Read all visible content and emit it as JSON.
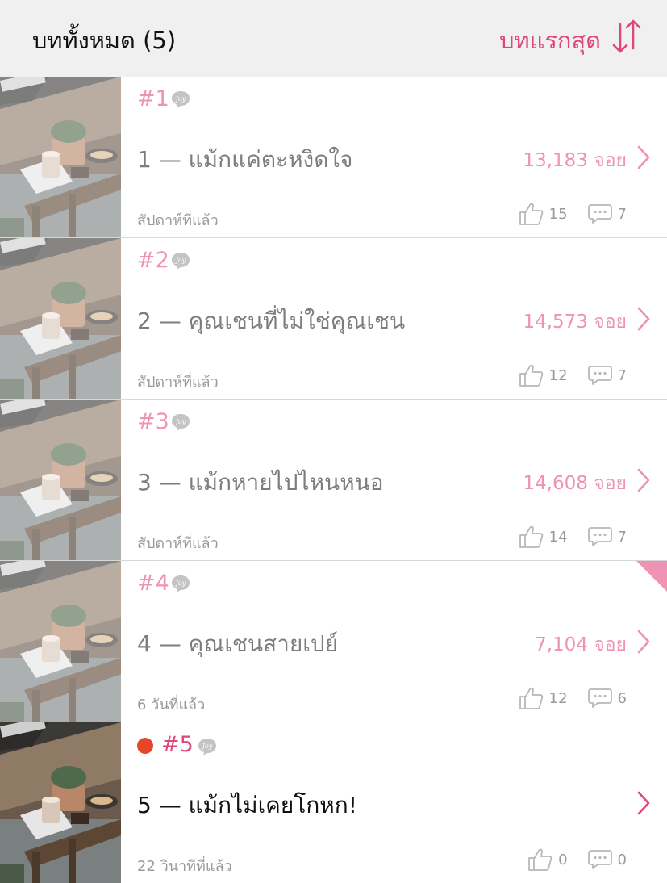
{
  "header": {
    "title": "บททั้งหมด (5)",
    "sort_label": "บทแรกสุด",
    "sort_icon": "sort-arrows-icon",
    "accent": "#e0467c"
  },
  "episodes": [
    {
      "number": "#1",
      "title": "1 — แม้กแค่ตะหงิดใจ",
      "views": "13,183 จอย",
      "time": "สัปดาห์ที่แล้ว",
      "likes": "15",
      "comments": "7"
    },
    {
      "number": "#2",
      "title": "2 — คุณเชนที่ไม่ใช่คุณเชน",
      "views": "14,573 จอย",
      "time": "สัปดาห์ที่แล้ว",
      "likes": "12",
      "comments": "7"
    },
    {
      "number": "#3",
      "title": "3 — แม้กหายไปไหนหนอ",
      "views": "14,608 จอย",
      "time": "สัปดาห์ที่แล้ว",
      "likes": "14",
      "comments": "7"
    },
    {
      "number": "#4",
      "title": "4 — คุณเชนสายเปย์",
      "views": "7,104 จอย",
      "time": "6 วันที่แล้ว",
      "likes": "12",
      "comments": "6"
    },
    {
      "number": "#5",
      "title": "5 — แม้กไม่เคยโกหก!",
      "views": "",
      "time": "22 วินาทีที่แล้ว",
      "likes": "0",
      "comments": "0"
    }
  ],
  "colors": {
    "pink_light": "#ef93b4",
    "pink_dark": "#e0467c",
    "new_dot": "#e8462b"
  }
}
